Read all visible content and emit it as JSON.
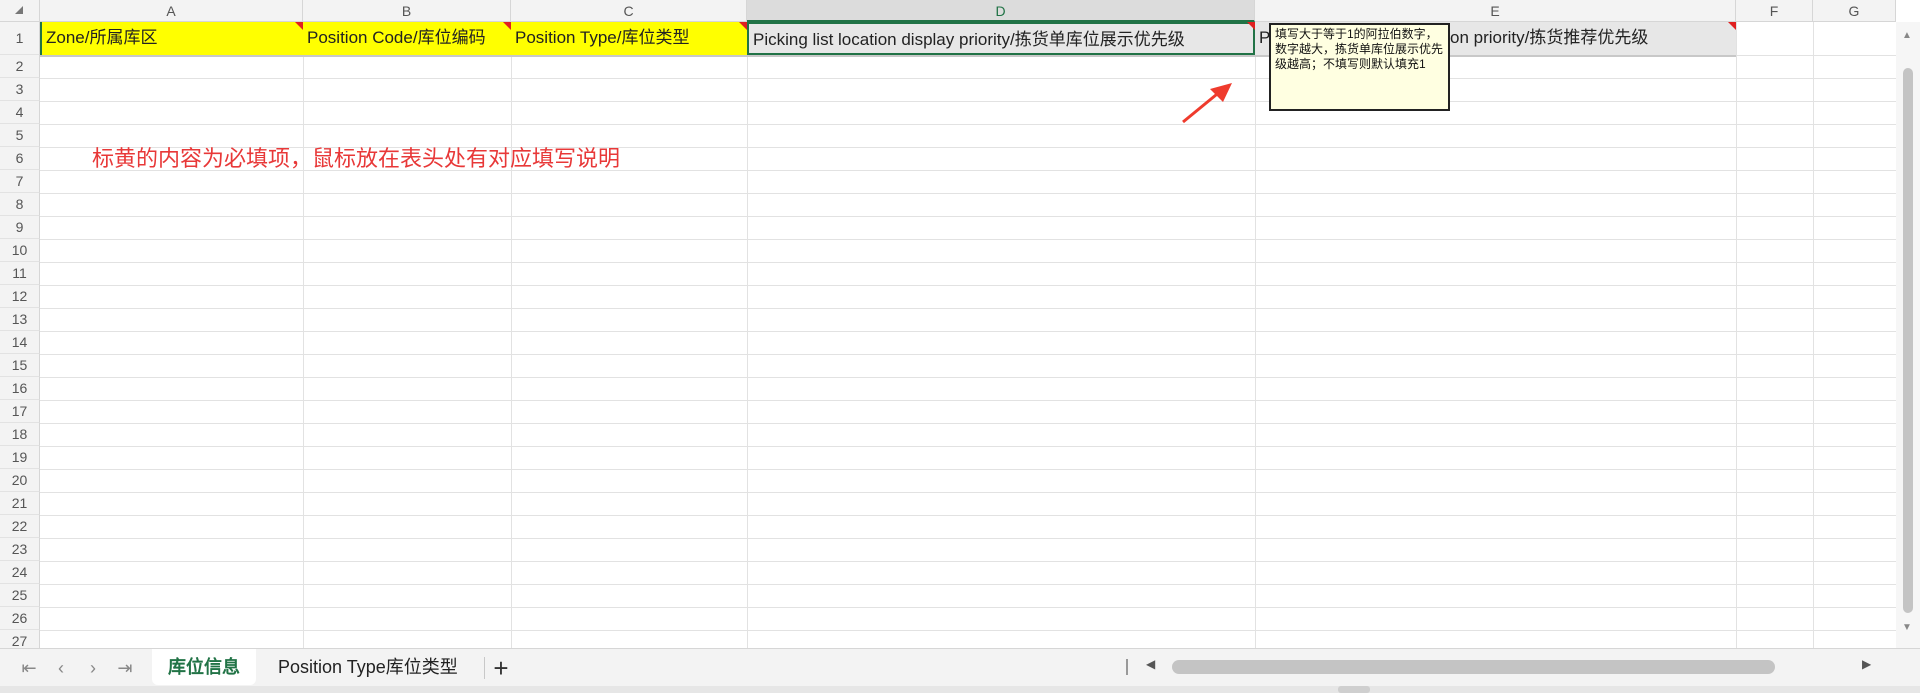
{
  "columns": [
    "A",
    "B",
    "C",
    "D",
    "E",
    "F",
    "G"
  ],
  "selected_column": "D",
  "rows": [
    "1",
    "2",
    "3",
    "4",
    "5",
    "6",
    "7",
    "8",
    "9",
    "10",
    "11",
    "12",
    "13",
    "14",
    "15",
    "16",
    "17",
    "18",
    "19",
    "20",
    "21",
    "22",
    "23",
    "24",
    "25",
    "26",
    "27"
  ],
  "header_cells": {
    "A": "Zone/所属库区",
    "B": "Position Code/库位编码",
    "C": "Position Type/库位类型",
    "D": "Picking list location display priority/拣货单库位展示优先级",
    "E_prefix": "P",
    "E_suffix": "on priority/拣货推荐优先级"
  },
  "comment_note": "填写大于等于1的阿拉伯数字，数字越大，拣货单库位展示优先级越高；不填写则默认填充1",
  "annotation_text": "标黄的内容为必填项，鼠标放在表头处有对应填写说明",
  "sheet_tabs": [
    "库位信息",
    "Position Type库位类型"
  ],
  "active_tab": "库位信息",
  "icons": {
    "first": "first-sheet-icon",
    "prev": "prev-sheet-icon",
    "next": "next-sheet-icon",
    "last": "last-sheet-icon",
    "add": "add-sheet-icon"
  },
  "colors": {
    "required_fill": "#ffff00",
    "accent": "#217346",
    "annotation": "#e83838"
  }
}
